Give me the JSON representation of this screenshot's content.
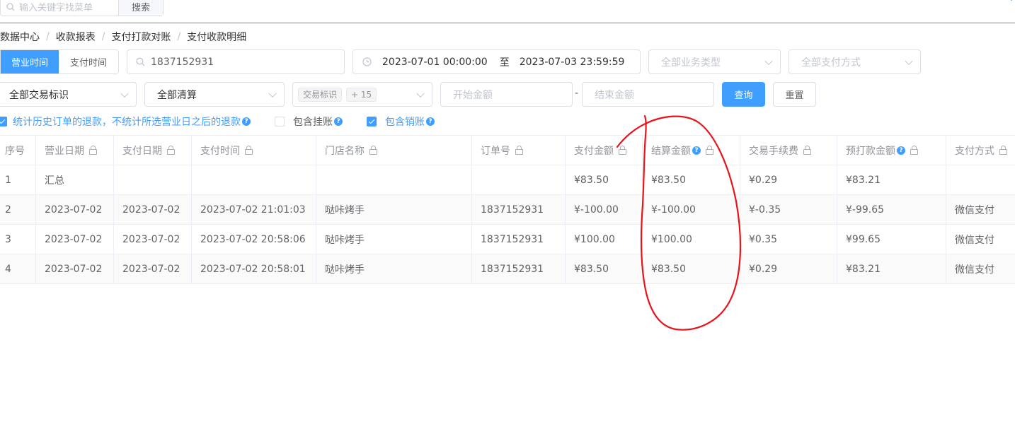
{
  "topbar": {
    "search_placeholder": "输入关键字找菜单",
    "search_button": "搜索"
  },
  "breadcrumb": [
    "数据中心",
    "收款报表",
    "支付打款对账",
    "支付收款明细"
  ],
  "filters": {
    "time_tabs": [
      "营业时间",
      "支付时间"
    ],
    "active_tab": "营业时间",
    "keyword_value": "1837152931",
    "date_start": "2023-07-01 00:00:00",
    "date_sep": "至",
    "date_end": "2023-07-03 23:59:59",
    "business_type_placeholder": "全部业务类型",
    "pay_method_placeholder": "全部支付方式",
    "trade_flag_placeholder": "全部交易标识",
    "settle_placeholder": "全部清算",
    "tag_label": "交易标识",
    "tag_more": "+ 15",
    "amount_start_placeholder": "开始金额",
    "amount_sep": "-",
    "amount_end_placeholder": "结束金额",
    "query_button": "查询",
    "reset_button": "重置"
  },
  "checkboxes": [
    {
      "label": "统计历史订单的退款，不统计所选营业日之后的退款",
      "checked": true
    },
    {
      "label": "包含挂账",
      "checked": false
    },
    {
      "label": "包含销账",
      "checked": true
    }
  ],
  "table": {
    "columns": [
      "序号",
      "营业日期",
      "支付日期",
      "支付时间",
      "门店名称",
      "订单号",
      "支付金额",
      "结算金额",
      "交易手续费",
      "预打款金额",
      "支付方式"
    ],
    "rows": [
      [
        "1",
        "汇总",
        "",
        "",
        "",
        "",
        "¥83.50",
        "¥83.50",
        "¥0.29",
        "¥83.21",
        ""
      ],
      [
        "2",
        "2023-07-02",
        "2023-07-02",
        "2023-07-02 21:01:03",
        "哒咔烤手",
        "1837152931",
        "¥-100.00",
        "¥-100.00",
        "¥-0.35",
        "¥-99.65",
        "微信支付"
      ],
      [
        "3",
        "2023-07-02",
        "2023-07-02",
        "2023-07-02 20:58:06",
        "哒咔烤手",
        "1837152931",
        "¥100.00",
        "¥100.00",
        "¥0.35",
        "¥99.65",
        "微信支付"
      ],
      [
        "4",
        "2023-07-02",
        "2023-07-02",
        "2023-07-02 20:58:01",
        "哒咔烤手",
        "1837152931",
        "¥83.50",
        "¥83.50",
        "¥0.29",
        "¥83.21",
        "微信支付"
      ]
    ]
  },
  "colors": {
    "primary": "#409eff",
    "annotation": "#e8141b"
  }
}
